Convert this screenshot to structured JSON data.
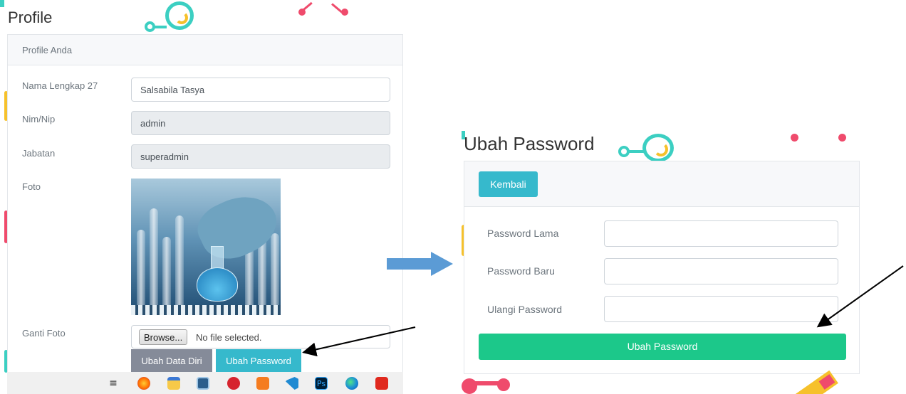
{
  "profile": {
    "page_title": "Profile",
    "card_header": "Profile Anda",
    "fields": {
      "nama_label": "Nama Lengkap 27",
      "nama_value": "Salsabila Tasya",
      "nim_label": "Nim/Nip",
      "nim_value": "admin",
      "jabatan_label": "Jabatan",
      "jabatan_value": "superadmin",
      "foto_label": "Foto",
      "ganti_foto_label": "Ganti Foto"
    },
    "file_input": {
      "browse_label": "Browse...",
      "status": "No file selected."
    },
    "buttons": {
      "ubah_data_diri": "Ubah Data Diri",
      "ubah_password": "Ubah Password"
    }
  },
  "taskbar": {
    "icons": [
      "task-view-icon",
      "firefox-icon",
      "file-explorer-icon",
      "terminal-icon",
      "red-app-icon",
      "xampp-icon",
      "vscode-icon",
      "photoshop-icon",
      "edge-icon",
      "acrobat-icon"
    ],
    "ps_label": "Ps"
  },
  "ubah_password": {
    "page_title": "Ubah Password",
    "kembali_label": "Kembali",
    "password_lama_label": "Password Lama",
    "password_baru_label": "Password Baru",
    "ulangi_password_label": "Ulangi Password",
    "submit_label": "Ubah Password"
  },
  "colors": {
    "teal": "#36b9cc",
    "green": "#1cc88a",
    "gray_button": "#858b99",
    "arrow_blue": "#5b9bd5",
    "decor_teal": "#3ccfc2",
    "decor_pink": "#ef4b6c",
    "decor_yellow": "#f6c12b"
  }
}
